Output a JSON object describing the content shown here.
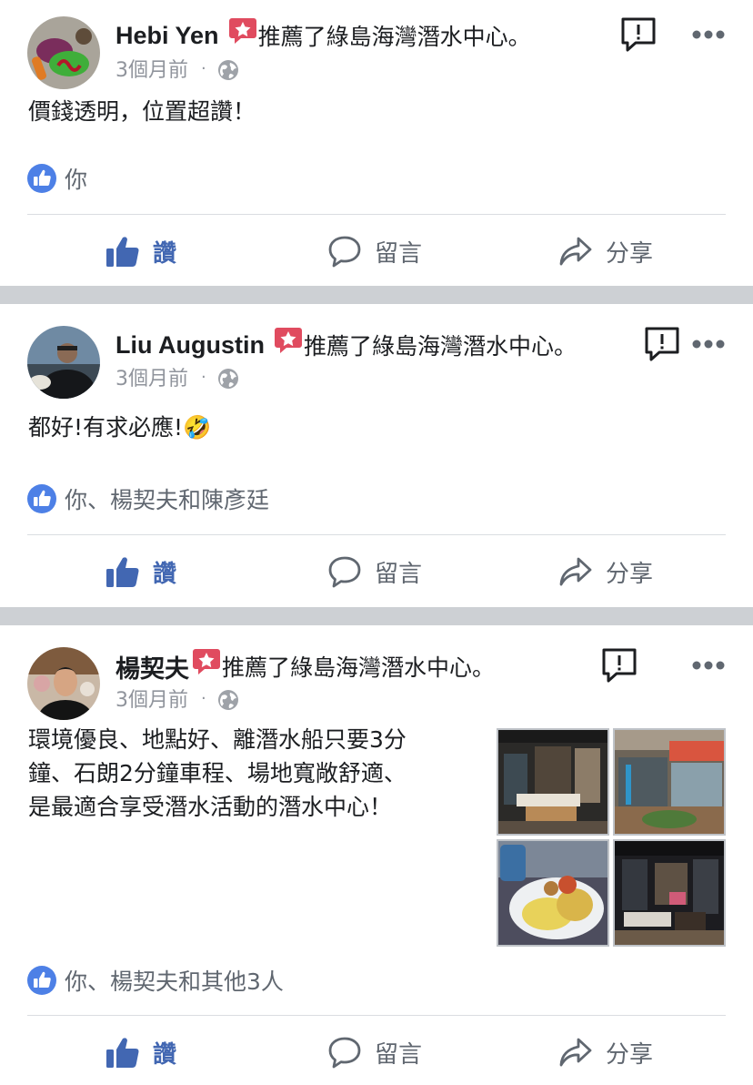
{
  "posts": [
    {
      "author": "Hebi Yen",
      "recommend_text": "推薦了綠島海灣潛水中心。",
      "time": "3個月前",
      "separator": "·",
      "body": "價錢透明，位置超讚！",
      "reactions": "你",
      "actions": {
        "like": "讚",
        "comment": "留言",
        "share": "分享"
      }
    },
    {
      "author": "Liu Augustin",
      "recommend_text": "推薦了綠島海灣潛水中心。",
      "time": "3個月前",
      "separator": "·",
      "body": "都好!有求必應!🤣",
      "reactions": "你、楊契夫和陳彥廷",
      "actions": {
        "like": "讚",
        "comment": "留言",
        "share": "分享"
      }
    },
    {
      "author": "楊契夫",
      "recommend_text": "推薦了綠島海灣潛水中心。",
      "time": "3個月前",
      "separator": "·",
      "body_lines": [
        "環境優良、地點好、離潛水船只要3分",
        "鐘、石朗2分鐘車程、場地寬敞舒適、",
        "是最適合享受潛水活動的潛水中心！"
      ],
      "reactions": "你、楊契夫和其他3人",
      "actions": {
        "like": "讚",
        "comment": "留言",
        "share": "分享"
      }
    }
  ],
  "colors": {
    "accent": "#4267b2",
    "recommend_badge": "#e04b5f",
    "meta": "#90949c",
    "separator": "#cdd0d4"
  },
  "icons": [
    "recommend-star-icon",
    "globe-icon",
    "report-icon",
    "more-icon",
    "like-badge-icon",
    "thumbs-up-icon",
    "comment-icon",
    "share-icon"
  ]
}
